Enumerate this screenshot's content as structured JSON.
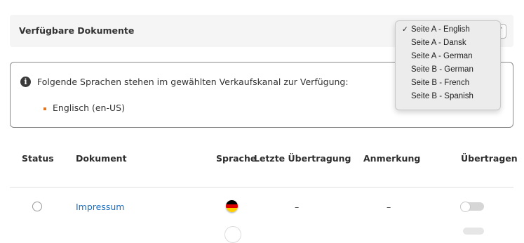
{
  "header": {
    "title": "Verfügbare Dokumente",
    "selected_page": "Seite A - English"
  },
  "info": {
    "icon": "info-icon",
    "text": "Folgende Sprachen stehen im gewählten Verkaufskanal zur Verfügung:",
    "languages": [
      "Englisch (en-US)"
    ]
  },
  "table": {
    "columns": [
      "Status",
      "Dokument",
      "Sprache",
      "Letzte Übertragung",
      "Anmerkung",
      "Übertragen"
    ],
    "rows": [
      {
        "status": "unselected",
        "document": "Impressum",
        "language_flag": "german-flag-icon",
        "last_transfer": "–",
        "note": "–",
        "transfer_toggle": "off"
      }
    ]
  },
  "dropdown": {
    "options": [
      {
        "label": "Seite A - English",
        "checked": true,
        "check_mark": "✓"
      },
      {
        "label": "Seite A - Dansk",
        "checked": false
      },
      {
        "label": "Seite A - German",
        "checked": false
      },
      {
        "label": "Seite B - German",
        "checked": false
      },
      {
        "label": "Seite B - French",
        "checked": false
      },
      {
        "label": "Seite B - Spanish",
        "checked": false
      }
    ]
  },
  "colors": {
    "link": "#1a6fc4",
    "bullet": "#e8731d",
    "header_bg": "#f5f5f6",
    "dropdown_bg": "#ececec"
  }
}
